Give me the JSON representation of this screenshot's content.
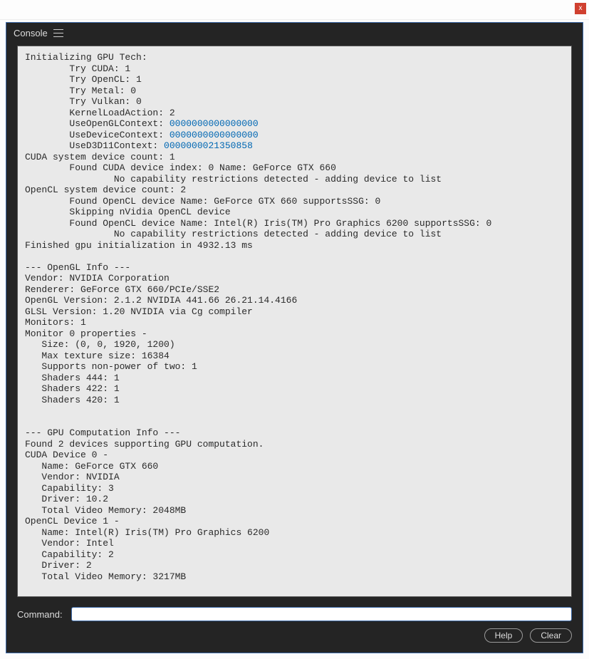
{
  "titlebar": {
    "close_glyph": "x"
  },
  "panel": {
    "title": "Console"
  },
  "output": {
    "l1": "Initializing GPU Tech:",
    "l2": "        Try CUDA: 1",
    "l3": "        Try OpenCL: 1",
    "l4": "        Try Metal: 0",
    "l5": "        Try Vulkan: 0",
    "l6": "        KernelLoadAction: 2",
    "l7a": "        UseOpenGLContext: ",
    "l7b": "0000000000000000",
    "l8a": "        UseDeviceContext: ",
    "l8b": "0000000000000000",
    "l9a": "        UseD3D11Context: ",
    "l9b": "0000000021350858",
    "l10": "CUDA system device count: 1",
    "l11": "        Found CUDA device index: 0 Name: GeForce GTX 660",
    "l12": "                No capability restrictions detected - adding device to list",
    "l13": "OpenCL system device count: 2",
    "l14": "        Found OpenCL device Name: GeForce GTX 660 supportsSSG: 0",
    "l15": "        Skipping nVidia OpenCL device",
    "l16": "        Found OpenCL device Name: Intel(R) Iris(TM) Pro Graphics 6200 supportsSSG: 0",
    "l17": "                No capability restrictions detected - adding device to list",
    "l18": "Finished gpu initialization in 4932.13 ms",
    "l19": "",
    "l20": "--- OpenGL Info ---",
    "l21": "Vendor: NVIDIA Corporation",
    "l22": "Renderer: GeForce GTX 660/PCIe/SSE2",
    "l23": "OpenGL Version: 2.1.2 NVIDIA 441.66 26.21.14.4166",
    "l24": "GLSL Version: 1.20 NVIDIA via Cg compiler",
    "l25": "Monitors: 1",
    "l26": "Monitor 0 properties - ",
    "l27": "   Size: (0, 0, 1920, 1200)",
    "l28": "   Max texture size: 16384",
    "l29": "   Supports non-power of two: 1",
    "l30": "   Shaders 444: 1",
    "l31": "   Shaders 422: 1",
    "l32": "   Shaders 420: 1",
    "l33": "",
    "l34": "",
    "l35": "--- GPU Computation Info ---",
    "l36": "Found 2 devices supporting GPU computation.",
    "l37": "CUDA Device 0 -",
    "l38": "   Name: GeForce GTX 660",
    "l39": "   Vendor: NVIDIA",
    "l40": "   Capability: 3",
    "l41": "   Driver: 10.2",
    "l42": "   Total Video Memory: 2048MB",
    "l43": "OpenCL Device 1 -",
    "l44": "   Name: Intel(R) Iris(TM) Pro Graphics 6200",
    "l45": "   Vendor: Intel",
    "l46": "   Capability: 2",
    "l47": "   Driver: 2",
    "l48": "   Total Video Memory: 3217MB"
  },
  "command": {
    "label": "Command:",
    "value": ""
  },
  "buttons": {
    "help": "Help",
    "clear": "Clear"
  }
}
